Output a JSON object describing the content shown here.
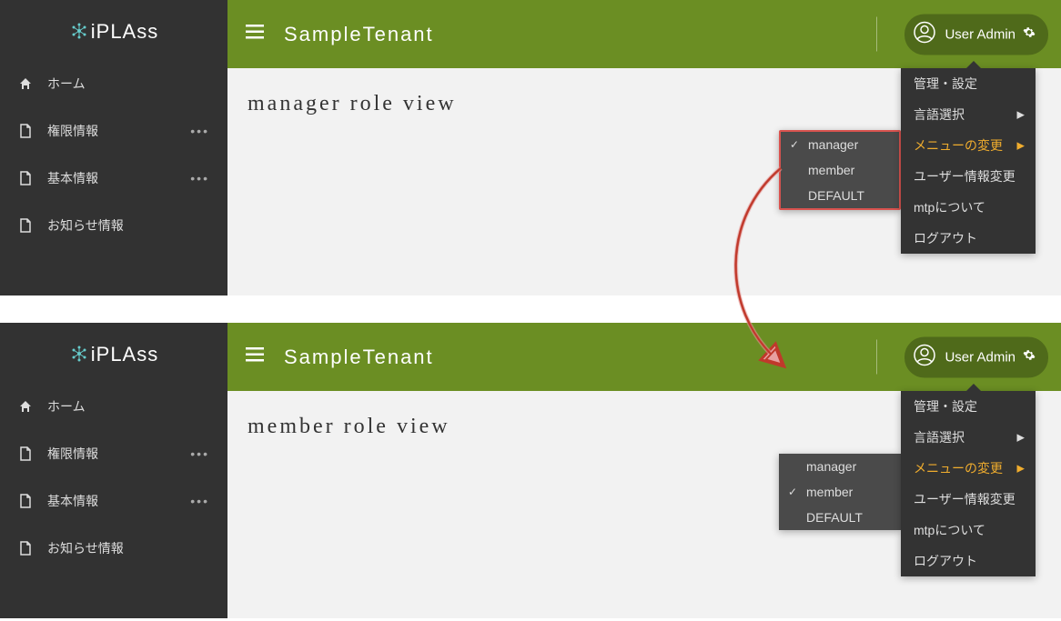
{
  "logo": {
    "text": "PLAss"
  },
  "sidebar": {
    "items": [
      {
        "label": "ホーム",
        "icon": "home",
        "dots": false
      },
      {
        "label": "権限情報",
        "icon": "document",
        "dots": true
      },
      {
        "label": "基本情報",
        "icon": "document",
        "dots": true
      },
      {
        "label": "お知らせ情報",
        "icon": "document",
        "dots": false
      }
    ]
  },
  "header": {
    "tenant": "SampleTenant",
    "user_label": "User Admin"
  },
  "content": {
    "title_top": "manager role view",
    "title_bottom": "member role view"
  },
  "dropdown": {
    "items": [
      {
        "label": "管理・設定",
        "chevron": false,
        "highlight": false
      },
      {
        "label": "言語選択",
        "chevron": true,
        "highlight": false
      },
      {
        "label": "メニューの変更",
        "chevron": true,
        "highlight": true
      },
      {
        "label": "ユーザー情報変更",
        "chevron": false,
        "highlight": false
      },
      {
        "label": "mtpについて",
        "chevron": false,
        "highlight": false
      },
      {
        "label": "ログアウト",
        "chevron": false,
        "highlight": false
      }
    ]
  },
  "role_menu": {
    "items": [
      {
        "label": "manager"
      },
      {
        "label": "member"
      },
      {
        "label": "DEFAULT"
      }
    ],
    "checked_top": 0,
    "checked_bottom": 1
  }
}
